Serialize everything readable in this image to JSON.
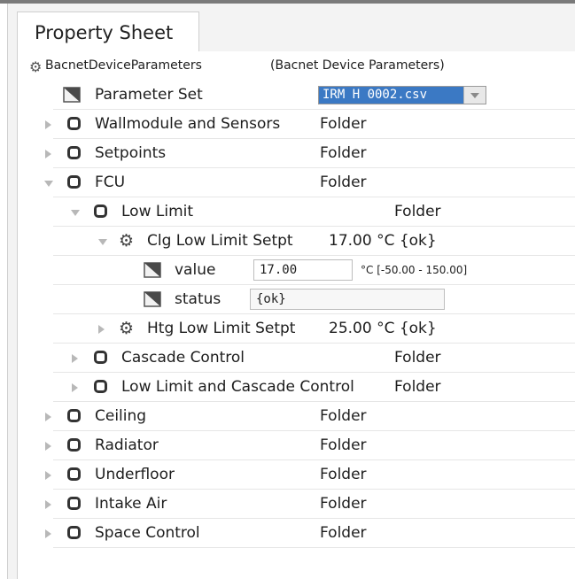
{
  "tab": {
    "label": "Property Sheet"
  },
  "root": {
    "name": "BacnetDeviceParameters",
    "type": "(Bacnet Device Parameters)"
  },
  "parameter_set": {
    "label": "Parameter Set",
    "value": "IRM H 0002.csv"
  },
  "rows": {
    "wallmodule": {
      "label": "Wallmodule and Sensors",
      "value": "Folder"
    },
    "setpoints": {
      "label": "Setpoints",
      "value": "Folder"
    },
    "fcu": {
      "label": "FCU",
      "value": "Folder"
    },
    "low_limit": {
      "label": "Low Limit",
      "value": "Folder"
    },
    "clg_low": {
      "label": "Clg Low Limit Setpt",
      "value": "17.00 °C {ok}"
    },
    "value_row": {
      "label": "value",
      "input": "17.00",
      "range": "°C [-50.00 - 150.00]"
    },
    "status_row": {
      "label": "status",
      "input": "{ok}"
    },
    "htg_low": {
      "label": "Htg Low Limit Setpt",
      "value": "25.00 °C {ok}"
    },
    "cascade": {
      "label": "Cascade Control",
      "value": "Folder"
    },
    "low_cascade": {
      "label": "Low Limit and Cascade Control",
      "value": "Folder"
    },
    "ceiling": {
      "label": "Ceiling",
      "value": "Folder"
    },
    "radiator": {
      "label": "Radiator",
      "value": "Folder"
    },
    "underfloor": {
      "label": "Underfloor",
      "value": "Folder"
    },
    "intake": {
      "label": "Intake Air",
      "value": "Folder"
    },
    "space": {
      "label": "Space Control",
      "value": "Folder"
    }
  }
}
